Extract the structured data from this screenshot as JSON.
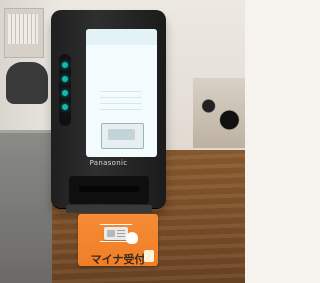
{
  "kiosk": {
    "brand": "Panasonic",
    "screen_title": "",
    "model": ""
  },
  "card_mat": {
    "note": "",
    "title": "マイナ受付"
  }
}
